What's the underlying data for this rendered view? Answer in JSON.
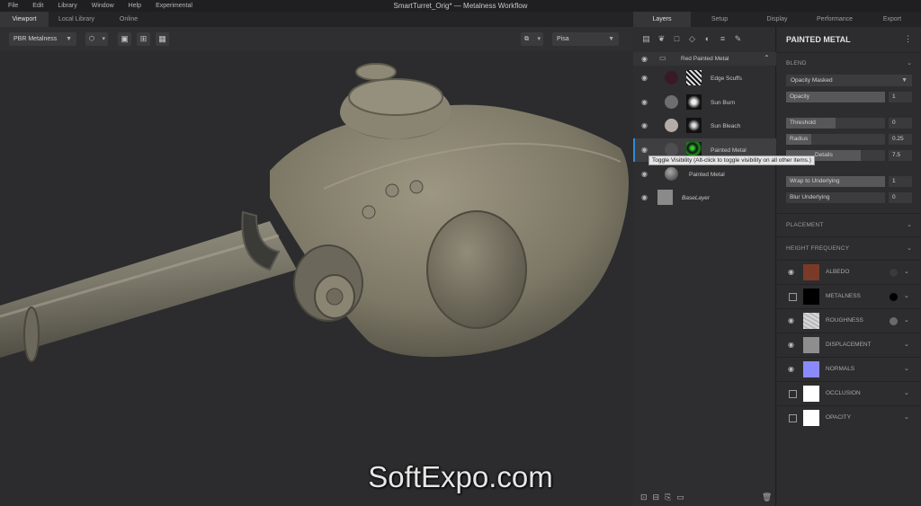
{
  "window": {
    "title": "SmartTurret_Orig* — Metalness Workflow"
  },
  "menu": [
    "File",
    "Edit",
    "Library",
    "Window",
    "Help",
    "Experimental"
  ],
  "left_tabs": [
    "Viewport",
    "Local Library",
    "Online"
  ],
  "viewport_toolbar": {
    "material_mode": "PBR Metalness",
    "environment": "Pisa"
  },
  "right_tabs": [
    "Layers",
    "Setup",
    "Display",
    "Performance",
    "Export"
  ],
  "layers": {
    "group": "Red Painted Metal",
    "items": [
      {
        "name": "Edge Scuffs",
        "swatch": "#3a1a22"
      },
      {
        "name": "Sun Burn",
        "swatch": "#6e6e6e"
      },
      {
        "name": "Sun Bleach",
        "swatch": "#b5aca7"
      },
      {
        "name": "Painted Metal",
        "swatch": "#4e4e50"
      },
      {
        "name": "Painted Metal",
        "swatch": "#5a5a5c"
      },
      {
        "name": "BaseLayer",
        "swatch": "#8a8a8a"
      }
    ],
    "tooltip": "Toggle Visibility (Alt-click to toggle visibility on all other items.)"
  },
  "properties": {
    "title": "PAINTED METAL",
    "blend_section": "BLEND",
    "blend_mode": "Opacity Masked",
    "opacity": {
      "label": "Opacity",
      "value": "1",
      "fill": 1.0
    },
    "threshold": {
      "label": "Threshold",
      "value": "0",
      "fill": 0.5
    },
    "radius": {
      "label": "Radius",
      "value": "0.25",
      "fill": 0.25
    },
    "details": {
      "label": "Details",
      "value": "7.5",
      "fill": 0.75
    },
    "wrap": {
      "label": "Wrap to Underlying",
      "value": "1",
      "fill": 1.0
    },
    "blur": {
      "label": "Blur Underlying",
      "value": "0",
      "fill": 0.0
    },
    "placement_section": "PLACEMENT",
    "height_section": "HEIGHT FREQUENCY",
    "channels": [
      {
        "name": "ALBEDO",
        "color": "#7a3a28",
        "dot": "#3a3a3c",
        "visible": true
      },
      {
        "name": "METALNESS",
        "color": "#000000",
        "dot": "#000000",
        "visible": false
      },
      {
        "name": "ROUGHNESS",
        "color": "#d0d0d0",
        "dot": "#6a6a6a",
        "visible": true
      },
      {
        "name": "DISPLACEMENT",
        "color": "#8e8e8e",
        "dot": "",
        "visible": true
      },
      {
        "name": "NORMALS",
        "color": "#8a8aff",
        "dot": "",
        "visible": true
      },
      {
        "name": "OCCLUSION",
        "color": "#ffffff",
        "dot": "",
        "visible": false
      },
      {
        "name": "OPACITY",
        "color": "#ffffff",
        "dot": "",
        "visible": false
      }
    ]
  },
  "watermark": "SoftExpo.com"
}
